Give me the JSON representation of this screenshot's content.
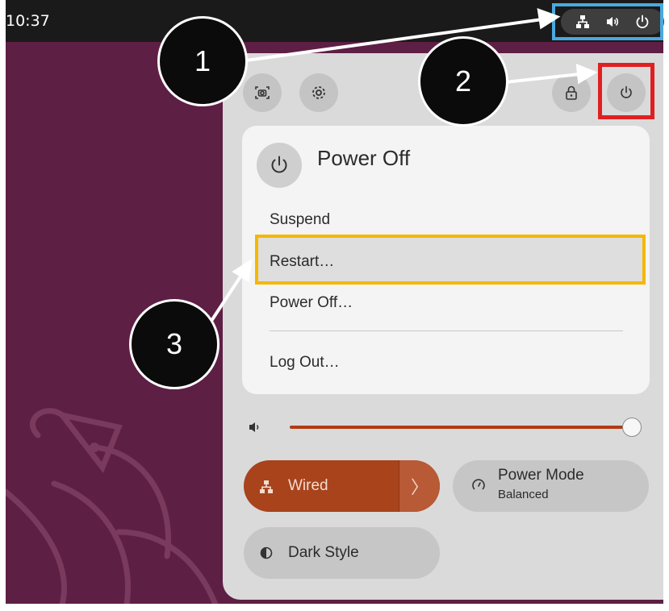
{
  "topbar": {
    "time": "10:37",
    "tray_icons": [
      "network-wired-icon",
      "volume-icon",
      "power-icon"
    ]
  },
  "panel": {
    "top_buttons": [
      "screenshot-icon",
      "settings-gear-icon",
      "lock-icon",
      "power-icon"
    ],
    "power_menu": {
      "title": "Power Off",
      "items": [
        "Suspend",
        "Restart…",
        "Power Off…",
        "Log Out…"
      ]
    },
    "volume": {
      "icon": "volume-icon",
      "level": 1.0
    },
    "tiles": {
      "wired": {
        "label": "Wired"
      },
      "power_mode": {
        "title": "Power Mode",
        "subtitle": "Balanced"
      },
      "dark_style": {
        "label": "Dark Style"
      }
    }
  },
  "annotations": {
    "callouts": [
      "1",
      "2",
      "3"
    ],
    "colors": {
      "tray_highlight": "#4aa9de",
      "power_button_highlight": "#e02020",
      "restart_highlight": "#f5b700"
    }
  },
  "colors": {
    "accent": "#a8431c",
    "desktop": "#5e1f45",
    "topbar": "#1a1a1a"
  }
}
